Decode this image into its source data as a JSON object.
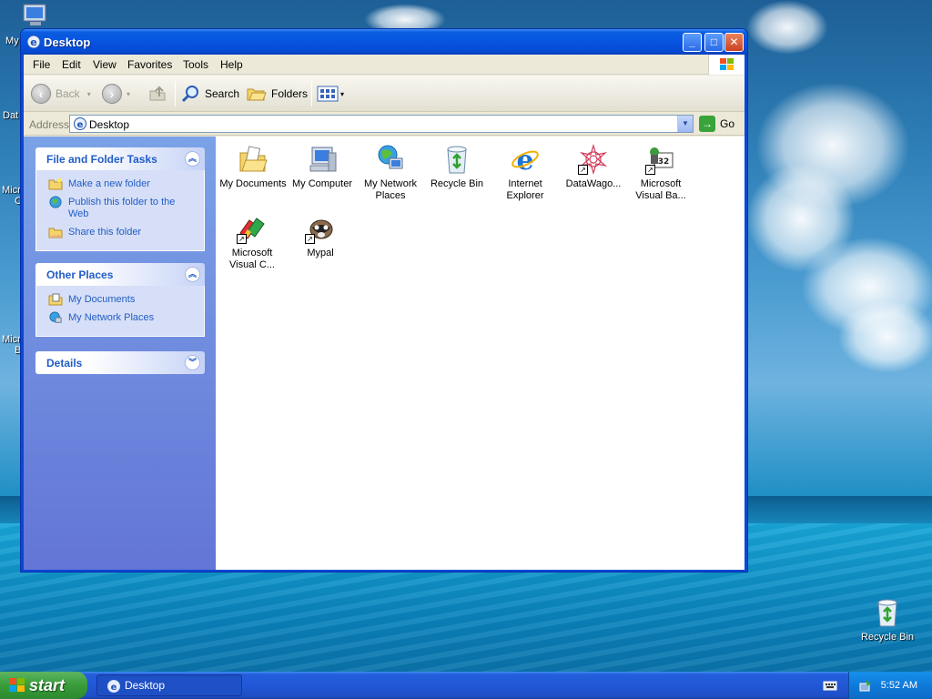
{
  "desktop": {
    "left_icons": [
      {
        "label": "My"
      },
      {
        "label": "Dat"
      },
      {
        "label": "Micro"
      },
      {
        "label": "C"
      },
      {
        "label": "Micro"
      },
      {
        "label": "B"
      }
    ],
    "recycle_bin_label": "Recycle Bin"
  },
  "window": {
    "title": "Desktop",
    "menu": [
      "File",
      "Edit",
      "View",
      "Favorites",
      "Tools",
      "Help"
    ],
    "toolbar": {
      "back": "Back",
      "search": "Search",
      "folders": "Folders"
    },
    "address": {
      "label": "Address",
      "value": "Desktop",
      "go": "Go"
    },
    "tasks_panel": {
      "title": "File and Folder Tasks",
      "items": [
        "Make a new folder",
        "Publish this folder to the Web",
        "Share this folder"
      ]
    },
    "other_places_panel": {
      "title": "Other Places",
      "items": [
        "My Documents",
        "My Network Places"
      ]
    },
    "details_panel": {
      "title": "Details"
    },
    "items": [
      {
        "label": "My Documents"
      },
      {
        "label": "My Computer"
      },
      {
        "label": "My Network Places"
      },
      {
        "label": "Recycle Bin"
      },
      {
        "label": "Internet Explorer"
      },
      {
        "label": "DataWago..."
      },
      {
        "label": "Microsoft Visual Ba..."
      },
      {
        "label": "Microsoft Visual C..."
      },
      {
        "label": "Mypal"
      }
    ]
  },
  "taskbar": {
    "start_label": "start",
    "task_label": "Desktop",
    "clock": "5:52 AM"
  },
  "colors": {
    "titlebar": "#0654e0",
    "task_link": "#215dc6",
    "start_green": "#389b3a"
  }
}
